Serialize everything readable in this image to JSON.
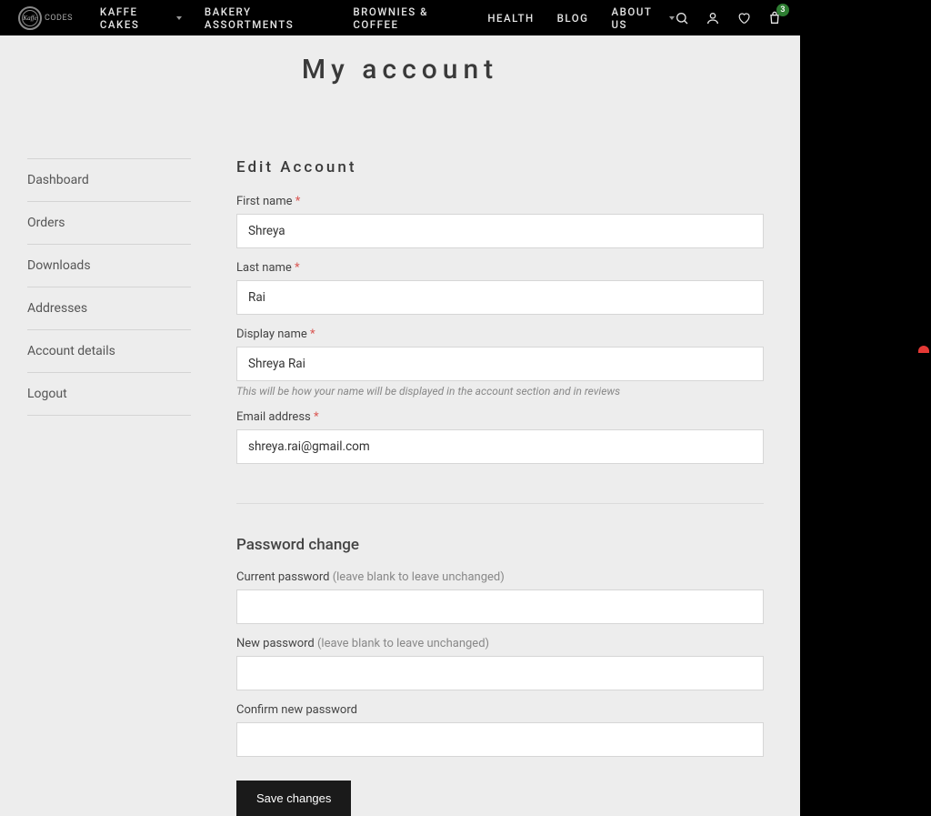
{
  "logo": {
    "script": "Kaffe",
    "text": "CODES"
  },
  "nav": {
    "items": [
      {
        "label": "KAFFE CAKES",
        "hasDropdown": true
      },
      {
        "label": "BAKERY ASSORTMENTS",
        "hasDropdown": false
      },
      {
        "label": "BROWNIES & COFFEE",
        "hasDropdown": false
      },
      {
        "label": "HEALTH",
        "hasDropdown": false
      },
      {
        "label": "BLOG",
        "hasDropdown": false
      },
      {
        "label": "ABOUT US",
        "hasDropdown": true
      }
    ]
  },
  "cart_count": "3",
  "page_title": "My account",
  "sidebar": {
    "items": [
      {
        "label": "Dashboard"
      },
      {
        "label": "Orders"
      },
      {
        "label": "Downloads"
      },
      {
        "label": "Addresses"
      },
      {
        "label": "Account details"
      },
      {
        "label": "Logout"
      }
    ]
  },
  "form": {
    "heading": "Edit Account",
    "first_name": {
      "label": "First name ",
      "value": "Shreya"
    },
    "last_name": {
      "label": "Last name ",
      "value": "Rai"
    },
    "display_name": {
      "label": "Display name ",
      "value": "Shreya Rai",
      "help": "This will be how your name will be displayed in the account section and in reviews"
    },
    "email": {
      "label": "Email address ",
      "value": "shreya.rai@gmail.com"
    },
    "required_marker": "*",
    "password_section": {
      "heading": "Password change",
      "current": {
        "label": "Current password ",
        "hint": "(leave blank to leave unchanged)"
      },
      "new": {
        "label": "New password ",
        "hint": "(leave blank to leave unchanged)"
      },
      "confirm": {
        "label": "Confirm new password"
      }
    },
    "save_button": "Save changes"
  }
}
